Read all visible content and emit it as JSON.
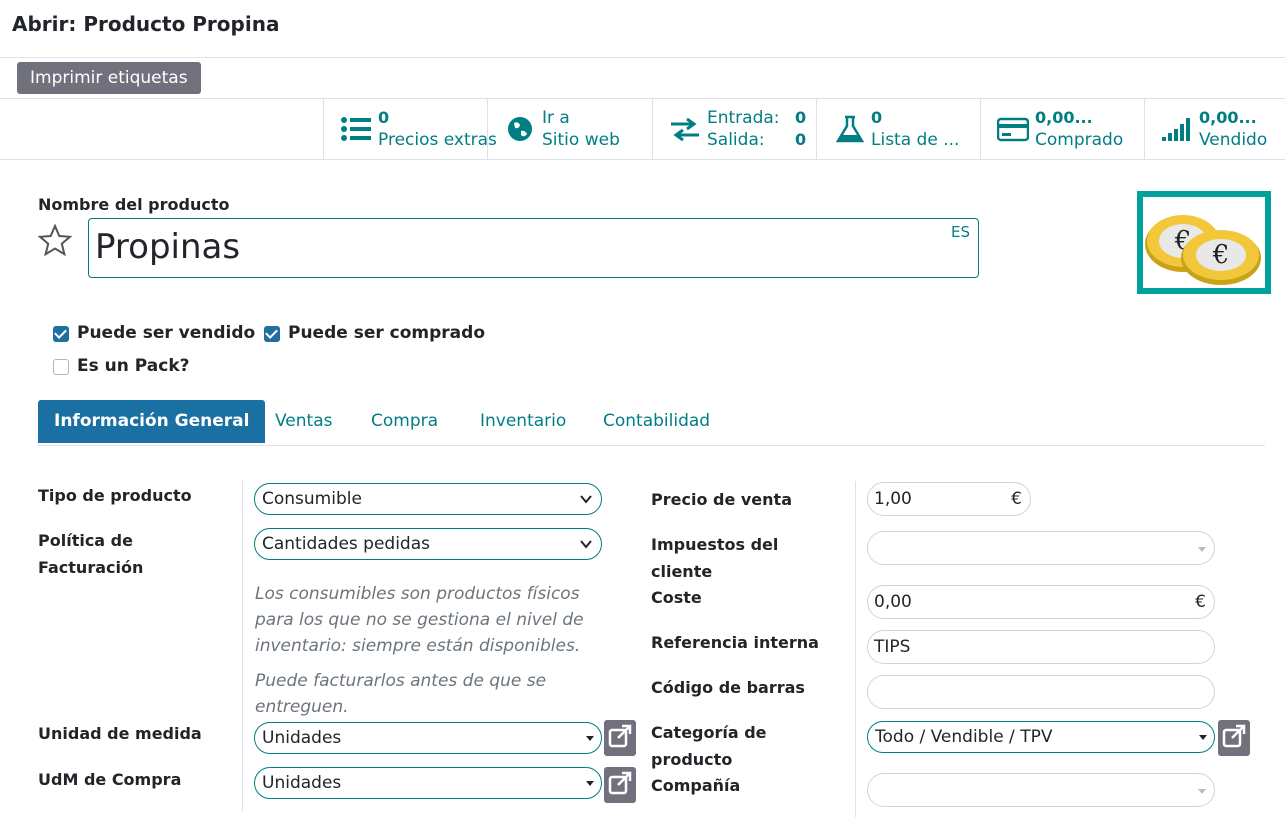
{
  "header": {
    "title": "Abrir: Producto Propina"
  },
  "toolbar": {
    "print_labels": "Imprimir etiquetas"
  },
  "smart_buttons": {
    "extra_prices": {
      "value": "0",
      "label": "Precios extras"
    },
    "website": {
      "line1": "Ir a",
      "line2": "Sitio web"
    },
    "moves": {
      "in_label": "Entrada:",
      "in_value": "0",
      "out_label": "Salida:",
      "out_value": "0"
    },
    "bom": {
      "value": "0",
      "label": "Lista de ..."
    },
    "purchased": {
      "value": "0,00...",
      "label": "Comprado"
    },
    "sold": {
      "value": "0,00...",
      "label": "Vendido"
    }
  },
  "product": {
    "name_label": "Nombre del producto",
    "name": "Propinas",
    "lang": "ES",
    "can_be_sold_label": "Puede ser vendido",
    "can_be_sold": true,
    "can_be_purchased_label": "Puede ser comprado",
    "can_be_purchased": true,
    "is_pack_label": "Es un Pack?",
    "is_pack": false,
    "image_icon": "euro-coins-icon"
  },
  "tabs": [
    "Información General",
    "Ventas",
    "Compra",
    "Inventario",
    "Contabilidad"
  ],
  "general": {
    "product_type_label": "Tipo de producto",
    "product_type": "Consumible",
    "invoice_policy_label_1": "Política de",
    "invoice_policy_label_2": "Facturación",
    "invoice_policy": "Cantidades pedidas",
    "help_1": "Los consumibles son productos físicos para los que no se gestiona el nivel de inventario: siempre están disponibles.",
    "help_2": "Puede facturarlos antes de que se entreguen.",
    "uom_label": "Unidad de medida",
    "uom": "Unidades",
    "purchase_uom_label": "UdM de Compra",
    "purchase_uom": "Unidades",
    "sale_price_label": "Precio de venta",
    "sale_price": "1,00",
    "currency": "€",
    "customer_taxes_label_1": "Impuestos del",
    "customer_taxes_label_2": "cliente",
    "customer_taxes": "",
    "cost_label": "Coste",
    "cost": "0,00",
    "internal_ref_label": "Referencia interna",
    "internal_ref": "TIPS",
    "barcode_label": "Código de barras",
    "barcode": "",
    "category_label_1": "Categoría de",
    "category_label_2": "producto",
    "category": "Todo / Vendible / TPV",
    "company_label": "Compañía",
    "company": ""
  },
  "colors": {
    "accent": "#017e84",
    "active_tab": "#1a6fa3",
    "image_border": "#00a09d"
  }
}
